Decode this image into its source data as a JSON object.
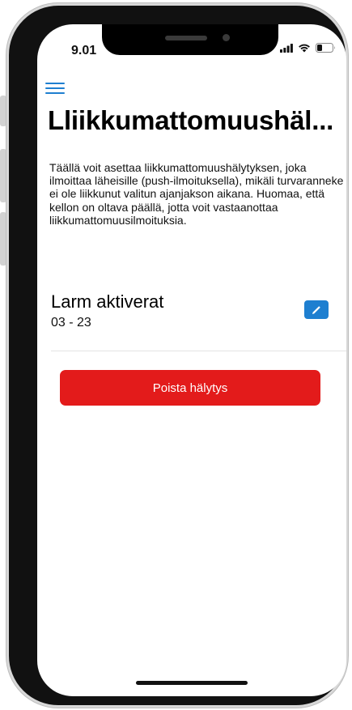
{
  "status_bar": {
    "time": "9.01",
    "icons": [
      "signal-icon",
      "wifi-icon",
      "battery-icon"
    ]
  },
  "header": {
    "menu_icon": "hamburger-menu-icon",
    "title": "Lliikkumattomuushäl..."
  },
  "description": "Täällä voit asettaa liikkumattomuushälytyksen, joka ilmoittaa läheisille (push-ilmoituksella), mikäli turvaranneke ei ole liikkunut valitun ajanjakson aikana. Huomaa, että kellon on oltava päällä, jotta voit vastaanottaa liikkumattomuusilmoituksia.",
  "alarm": {
    "title": "Larm aktiverat",
    "time_range": "03 - 23",
    "edit_icon": "pencil-icon"
  },
  "actions": {
    "delete_label": "Poista hälytys"
  },
  "colors": {
    "accent": "#1e7fd0",
    "danger": "#e31b1b"
  }
}
